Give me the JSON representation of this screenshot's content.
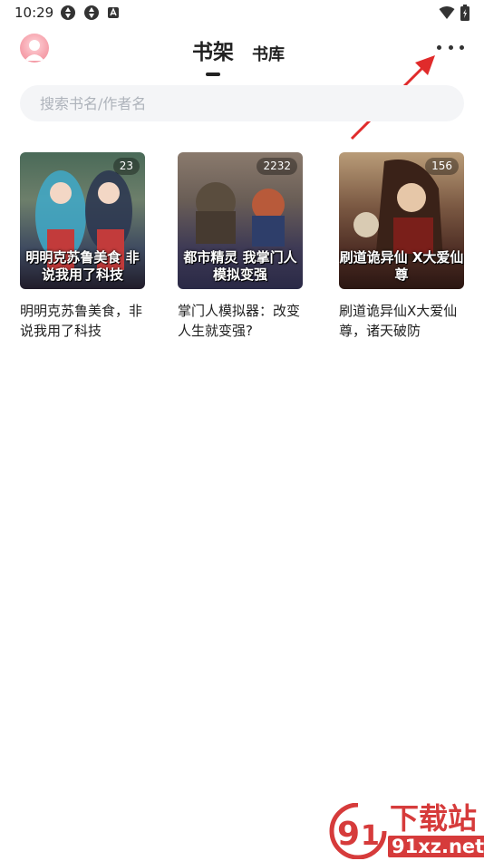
{
  "status_bar": {
    "time": "10:29",
    "left_icons": [
      "sync-icon",
      "sync-icon",
      "app-notification-icon"
    ],
    "right_icons": [
      "wifi-icon",
      "battery-icon"
    ]
  },
  "header": {
    "tabs": [
      {
        "label": "书架",
        "active": true
      },
      {
        "label": "书库",
        "active": false
      }
    ],
    "more_icon": "more-dots-icon"
  },
  "search": {
    "placeholder": "搜索书名/作者名"
  },
  "books": [
    {
      "cover_text": "明明克苏鲁美食 非说我用了科技",
      "badge": "23",
      "title": "明明克苏鲁美食，非说我用了科技"
    },
    {
      "cover_text": "都市精灵 我掌门人 模拟变强",
      "badge": "2232",
      "title": "掌门人模拟器：改变人生就变强?"
    },
    {
      "cover_text": "刷道诡异仙 X大爱仙尊",
      "badge": "156",
      "title": "刷道诡异仙X大爱仙尊，诸天破防"
    }
  ],
  "watermark": {
    "line1": "下载站",
    "line2": "91xz.net"
  },
  "colors": {
    "annotation_arrow": "#e02b2b",
    "watermark": "#d63b3b",
    "search_bg": "#f4f5f7"
  }
}
